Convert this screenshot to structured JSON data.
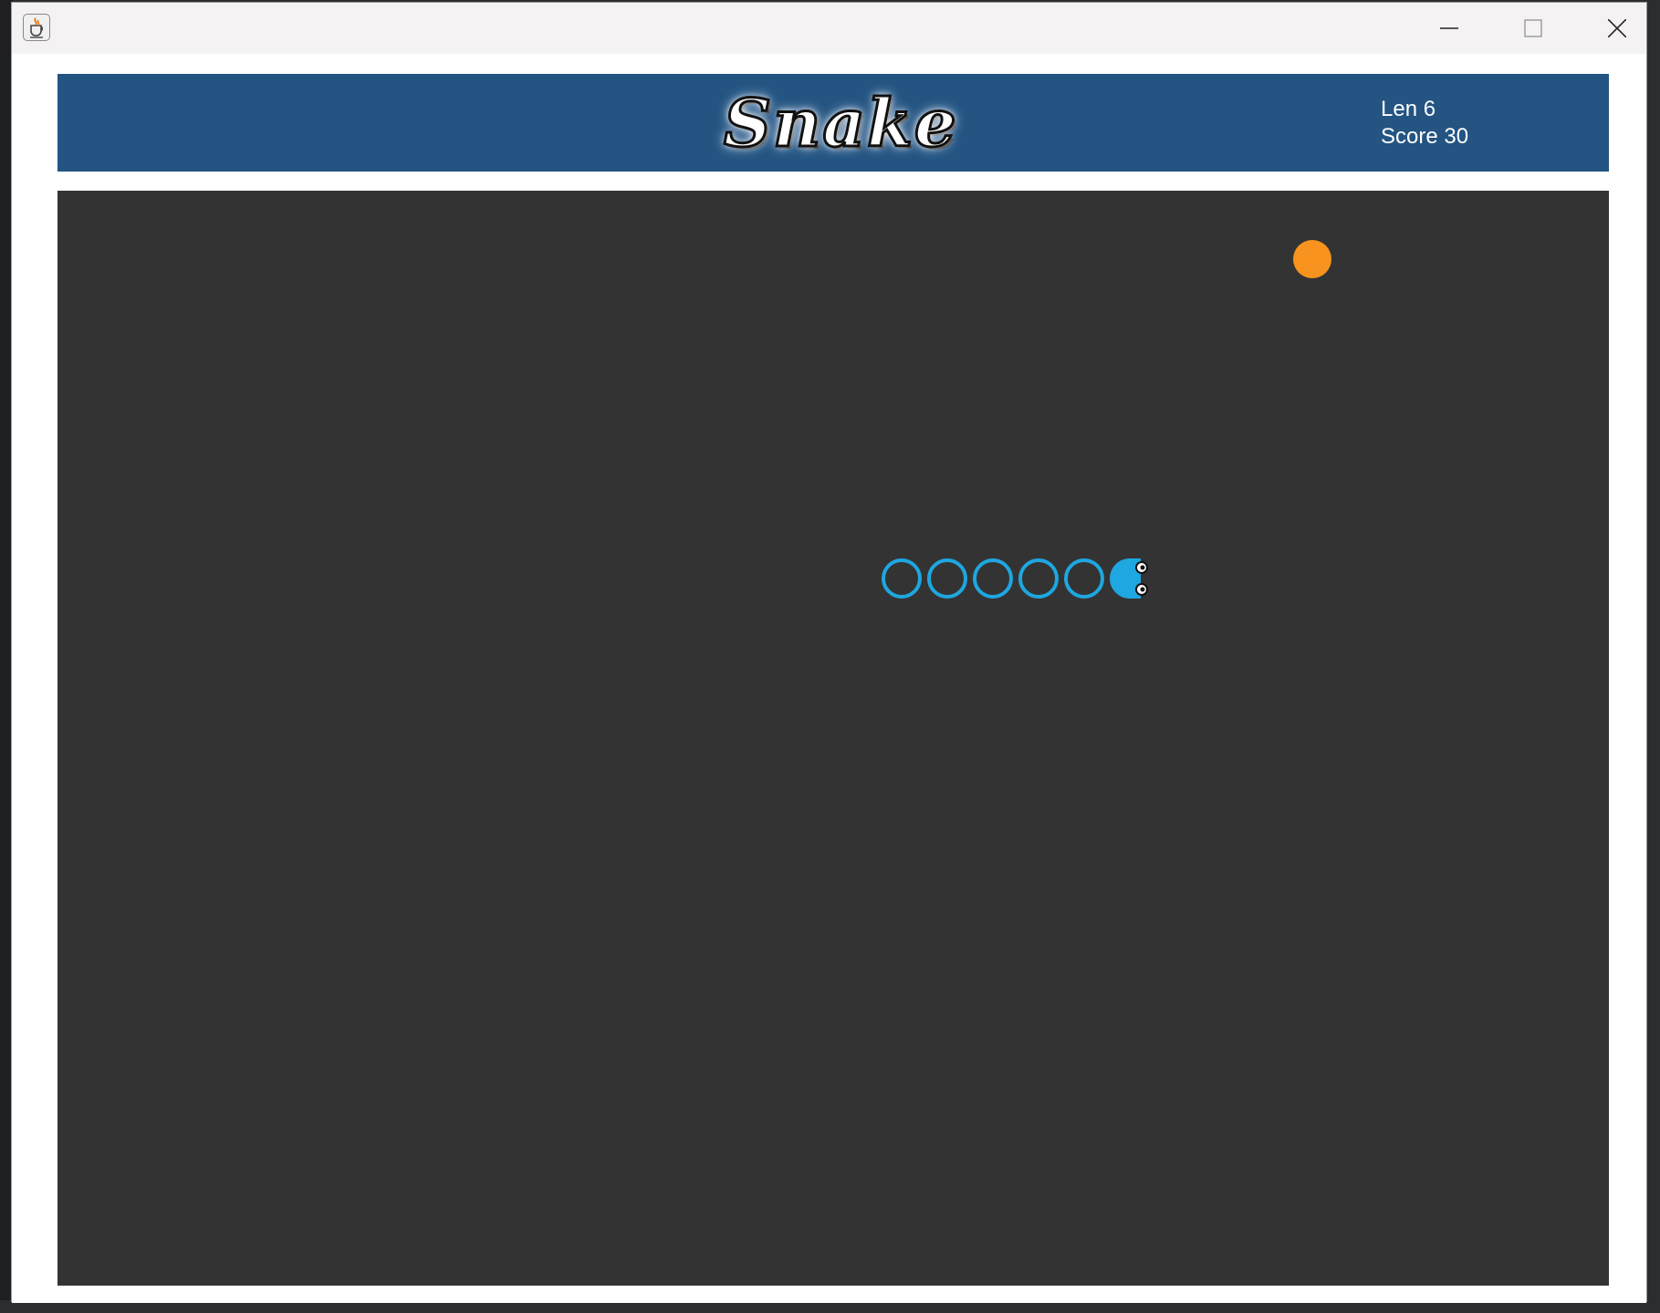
{
  "window": {
    "app_icon": "java-cup-icon",
    "controls": [
      "minimize-icon",
      "maximize-icon",
      "close-icon"
    ]
  },
  "header": {
    "logo_text": "Snake",
    "length_label": "Len 6",
    "score_label": "Score 30"
  },
  "game": {
    "snake_length": 6,
    "score": 30,
    "direction": "right",
    "colors": {
      "board": "#333333",
      "header": "#235482",
      "snake": "#1ea7e0",
      "food": "#f7931e"
    }
  }
}
